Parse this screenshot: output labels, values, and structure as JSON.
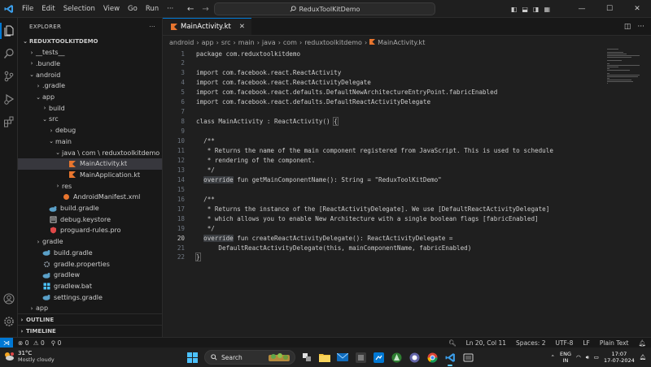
{
  "titlebar": {
    "menu": [
      "File",
      "Edit",
      "Selection",
      "View",
      "Go",
      "Run"
    ],
    "more": "···",
    "search": "ReduxToolKitDemo"
  },
  "sidebar": {
    "title": "EXPLORER",
    "more": "···",
    "tree": [
      {
        "label": "REDUXTOOLKITDEMO",
        "indent": 0,
        "chev": "v",
        "icon": "none",
        "root": true
      },
      {
        "label": "__tests__",
        "indent": 1,
        "chev": ">",
        "icon": "none"
      },
      {
        "label": ".bundle",
        "indent": 1,
        "chev": ">",
        "icon": "none"
      },
      {
        "label": "android",
        "indent": 1,
        "chev": "v",
        "icon": "none"
      },
      {
        "label": ".gradle",
        "indent": 2,
        "chev": ">",
        "icon": "none"
      },
      {
        "label": "app",
        "indent": 2,
        "chev": "v",
        "icon": "none"
      },
      {
        "label": "build",
        "indent": 3,
        "chev": ">",
        "icon": "none"
      },
      {
        "label": "src",
        "indent": 3,
        "chev": "v",
        "icon": "none"
      },
      {
        "label": "debug",
        "indent": 4,
        "chev": ">",
        "icon": "none"
      },
      {
        "label": "main",
        "indent": 4,
        "chev": "v",
        "icon": "none"
      },
      {
        "label": "java \\ com \\ reduxtoolkitdemo",
        "indent": 5,
        "chev": "v",
        "icon": "none"
      },
      {
        "label": "MainActivity.kt",
        "indent": 6,
        "chev": "",
        "icon": "kotlin",
        "selected": true
      },
      {
        "label": "MainApplication.kt",
        "indent": 6,
        "chev": "",
        "icon": "kotlin"
      },
      {
        "label": "res",
        "indent": 5,
        "chev": ">",
        "icon": "none"
      },
      {
        "label": "AndroidManifest.xml",
        "indent": 5,
        "chev": "",
        "icon": "xml"
      },
      {
        "label": "build.gradle",
        "indent": 3,
        "chev": "",
        "icon": "gradle"
      },
      {
        "label": "debug.keystore",
        "indent": 3,
        "chev": "",
        "icon": "keystore"
      },
      {
        "label": "proguard-rules.pro",
        "indent": 3,
        "chev": "",
        "icon": "proguard"
      },
      {
        "label": "gradle",
        "indent": 2,
        "chev": ">",
        "icon": "none"
      },
      {
        "label": "build.gradle",
        "indent": 2,
        "chev": "",
        "icon": "gradle"
      },
      {
        "label": "gradle.properties",
        "indent": 2,
        "chev": "",
        "icon": "gear"
      },
      {
        "label": "gradlew",
        "indent": 2,
        "chev": "",
        "icon": "gradle"
      },
      {
        "label": "gradlew.bat",
        "indent": 2,
        "chev": "",
        "icon": "bat"
      },
      {
        "label": "settings.gradle",
        "indent": 2,
        "chev": "",
        "icon": "gradle"
      },
      {
        "label": "app",
        "indent": 1,
        "chev": ">",
        "icon": "none"
      }
    ],
    "outline": "OUTLINE",
    "timeline": "TIMELINE"
  },
  "editor": {
    "tab": "MainActivity.kt",
    "breadcrumb": [
      "android",
      "app",
      "src",
      "main",
      "java",
      "com",
      "reduxtoolkitdemo",
      "MainActivity.kt"
    ],
    "lines": [
      "package com.reduxtoolkitdemo",
      "",
      "import com.facebook.react.ReactActivity",
      "import com.facebook.react.ReactActivityDelegate",
      "import com.facebook.react.defaults.DefaultNewArchitectureEntryPoint.fabricEnabled",
      "import com.facebook.react.defaults.DefaultReactActivityDelegate",
      "",
      "class MainActivity : ReactActivity() {",
      "",
      "  /**",
      "   * Returns the name of the main component registered from JavaScript. This is used to schedule",
      "   * rendering of the component.",
      "   */",
      "  override fun getMainComponentName(): String = \"ReduxToolKitDemo\"",
      "",
      "  /**",
      "   * Returns the instance of the [ReactActivityDelegate]. We use [DefaultReactActivityDelegate]",
      "   * which allows you to enable New Architecture with a single boolean flags [fabricEnabled]",
      "   */",
      "  override fun createReactActivityDelegate(): ReactActivityDelegate =",
      "      DefaultReactActivityDelegate(this, mainComponentName, fabricEnabled)",
      "}"
    ],
    "current_line": 20
  },
  "statusbar": {
    "errors": "0",
    "warnings": "0",
    "ports": "0",
    "position": "Ln 20, Col 11",
    "spaces": "Spaces: 2",
    "encoding": "UTF-8",
    "eol": "LF",
    "language": "Plain Text"
  },
  "taskbar": {
    "temp": "31°C",
    "weather": "Mostly cloudy",
    "search": "Search",
    "lang1": "ENG",
    "lang2": "IN",
    "time": "17:07",
    "date": "17-07-2024"
  },
  "colors": {
    "accent": "#0078d4",
    "kotlin": "#e8752e",
    "gradle": "#5aa0c8"
  }
}
